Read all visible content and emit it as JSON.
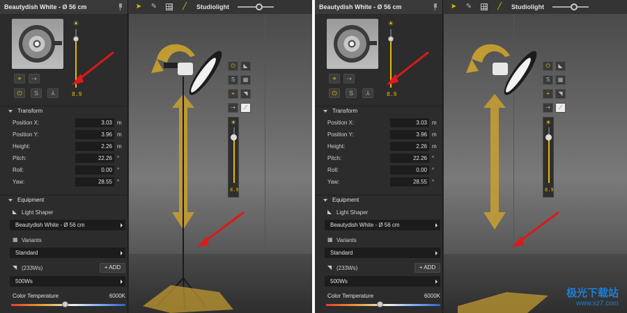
{
  "panel": {
    "title": "Beautydish White - Ø 56 cm",
    "intensity_value": "8.9",
    "power_button": "⏻",
    "solo_button": "S",
    "tripod_button": "⅄"
  },
  "transform": {
    "header": "Transform",
    "rows": [
      {
        "label": "Position X:",
        "value": "3.03",
        "unit": "m"
      },
      {
        "label": "Position Y:",
        "value": "3.96",
        "unit": "m"
      },
      {
        "label": "Height:",
        "value": "2.26",
        "unit": "m"
      },
      {
        "label": "Pitch:",
        "value": "22.26",
        "unit": "°"
      },
      {
        "label": "Roll:",
        "value": "0.00",
        "unit": "°"
      },
      {
        "label": "Yaw:",
        "value": "28.55",
        "unit": "°"
      }
    ]
  },
  "equipment": {
    "header": "Equipment",
    "light_shaper_label": "Light Shaper",
    "light_shaper_value": "Beautydish White - Ø 56 cm",
    "variants_label": "Variants",
    "variants_value": "Standard",
    "flash_label": "(233Ws)",
    "add_label": "+ ADD",
    "power_value": "500Ws",
    "color_temp_label": "Color Temperature",
    "color_temp_value": "6000K"
  },
  "toolbar": {
    "studiolight_label": "Studiolight"
  },
  "viewport": {
    "intensity_value": "8.9",
    "solo_label": "S"
  },
  "watermark": {
    "logo_text": "极光下载站",
    "url": "www.xz7.com"
  },
  "colors": {
    "accent": "#e8b800",
    "arrow": "#e01818",
    "panel_bg": "#2c2c2c"
  }
}
